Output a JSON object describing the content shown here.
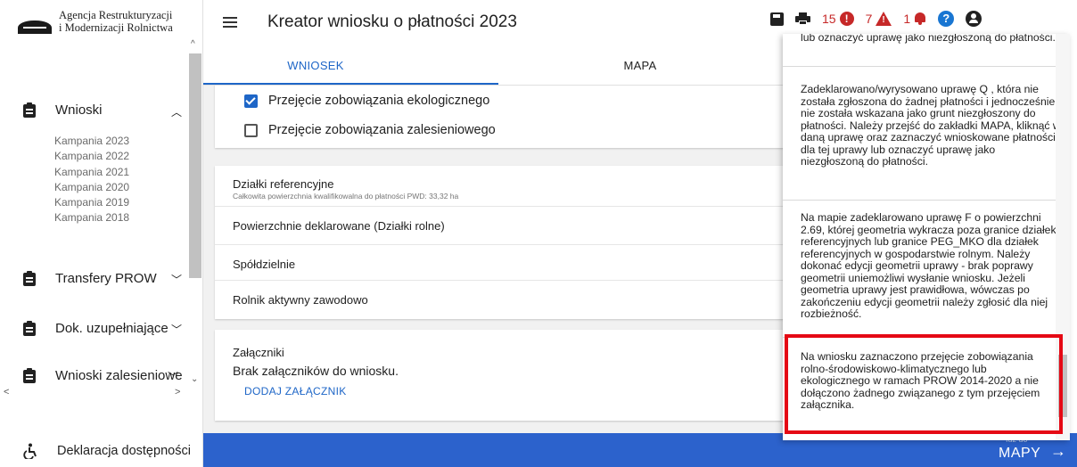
{
  "sidebar": {
    "logo_line1": "Agencja Restrukturyzacji",
    "logo_line2": "i Modernizacji Rolnictwa",
    "wnioski_label": "Wnioski",
    "campaigns": [
      "Kampania 2023",
      "Kampania 2022",
      "Kampania 2021",
      "Kampania 2020",
      "Kampania 2019",
      "Kampania 2018"
    ],
    "transfery_label": "Transfery PROW",
    "dok_label": "Dok. uzupełniające",
    "zalesieniowe_label": "Wnioski zalesieniowe",
    "accessibility_label": "Deklaracja dostępności"
  },
  "header": {
    "title": "Kreator wniosku o płatności 2023",
    "error_count": "15",
    "warning_count": "7",
    "notice_count": "1"
  },
  "tabs": {
    "wniosek": "WNIOSEK",
    "mapa": "MAPA"
  },
  "form": {
    "checkbox_ecological": "Przejęcie zobowiązania ekologicznego",
    "checkbox_ecological_checked": true,
    "checkbox_afforestation": "Przejęcie zobowiązania zalesieniowego",
    "checkbox_afforestation_checked": false,
    "parcels_title": "Działki referencyjne",
    "parcels_sub": "Całkowita powierzchnia kwalifikowalna do płatności PWD: 33,32 ha",
    "declared_areas": "Powierzchnie deklarowane (Działki rolne)",
    "cooperatives": "Spółdzielnie",
    "active_farmer": "Rolnik aktywny zawodowo",
    "attachments_title": "Załączniki",
    "attachments_empty": "Brak załączników do wniosku.",
    "add_attachment": "DODAJ ZAŁĄCZNIK"
  },
  "bottom": {
    "go_small": "Idź do",
    "go_big": "MAPY"
  },
  "messages": [
    "lub oznaczyć uprawę jako niezgłoszoną do płatności.",
    "Zadeklarowano/wyrysowano uprawę Q , która nie została zgłoszona do żadnej płatności i jednocześnie nie została wskazana jako grunt niezgłoszony do płatności. Należy przejść do zakładki MAPA, kliknąć w daną uprawę oraz zaznaczyć wnioskowane płatności dla tej uprawy lub oznaczyć uprawę jako niezgłoszoną do płatności.",
    "Na mapie zadeklarowano uprawę F o powierzchni 2.69, której geometria wykracza poza granice działek referencyjnych lub granice PEG_MKO dla działek referencyjnych w gospodarstwie rolnym. Należy dokonać edycji geometrii uprawy - brak poprawy geometrii uniemożliwi wysłanie wniosku. Jeżeli geometria uprawy jest prawidłowa, wówczas po zakończeniu edycji geometrii należy zgłosić dla niej rozbieżność.",
    "Na wniosku zaznaczono przejęcie zobowiązania rolno-środowiskowo-klimatycznego lub ekologicznego w ramach PROW 2014-2020 a nie dołączono żadnego związanego z tym przejęciem załącznika."
  ],
  "colors": {
    "accent": "#1e66c7",
    "bottom_bar": "#2c62cc",
    "error": "#c62828",
    "highlight": "#e50914"
  }
}
